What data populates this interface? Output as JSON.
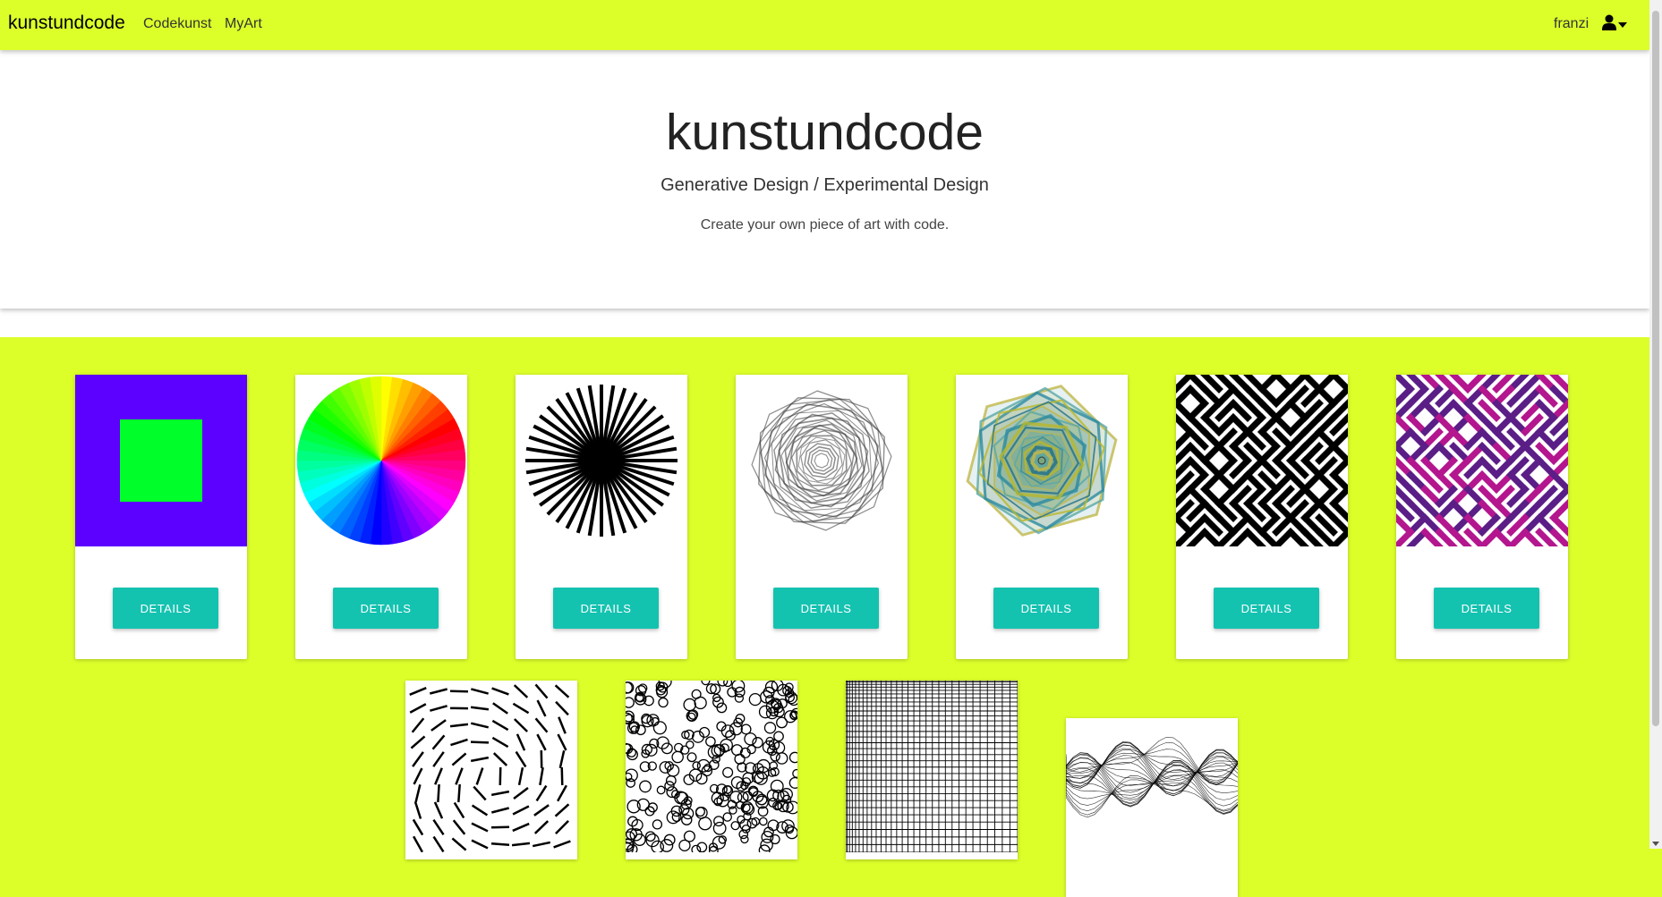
{
  "nav": {
    "brand": "kunstundcode",
    "links": [
      "Codekunst",
      "MyArt"
    ],
    "username": "franzi",
    "user_icon": "user-icon"
  },
  "hero": {
    "title": "kunstundcode",
    "subtitle": "Generative Design / Experimental Design",
    "lead": "Create your own piece of art with code."
  },
  "cards": [
    {
      "artwork": "square-on-purple",
      "button": "DETAILS"
    },
    {
      "artwork": "color-wheel",
      "button": "DETAILS"
    },
    {
      "artwork": "black-starburst",
      "button": "DETAILS"
    },
    {
      "artwork": "grey-octagon-rings",
      "button": "DETAILS"
    },
    {
      "artwork": "colored-hexagon-rings",
      "button": "DETAILS"
    },
    {
      "artwork": "black-maze-pattern",
      "button": "DETAILS"
    },
    {
      "artwork": "magenta-maze-pattern",
      "button": "DETAILS"
    }
  ],
  "cards_row2": [
    {
      "artwork": "line-flow-field"
    },
    {
      "artwork": "circle-scatter"
    },
    {
      "artwork": "grid-mesh"
    },
    {
      "artwork": "wave-sculpture"
    }
  ],
  "colors": {
    "accent": "#dcff2a",
    "button": "#14c2b0",
    "purple": "#5c00ff",
    "green": "#00ff2a",
    "magenta": "#b3168e",
    "indigo": "#5a1e86"
  }
}
